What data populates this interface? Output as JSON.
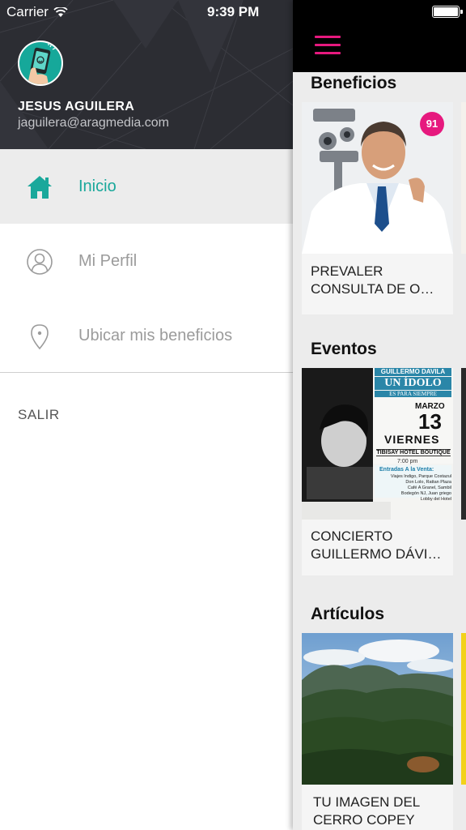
{
  "status_bar": {
    "carrier": "Carrier",
    "time": "9:39 PM"
  },
  "drawer": {
    "user": {
      "name": "JESUS AGUILERA",
      "email": "jaguilera@aragmedia.com"
    },
    "menu": [
      {
        "label": "Inicio",
        "icon": "home-icon",
        "active": true
      },
      {
        "label": "Mi Perfil",
        "icon": "user-icon",
        "active": false
      },
      {
        "label": "Ubicar mis beneficios",
        "icon": "location-pin-icon",
        "active": false
      }
    ],
    "logout_label": "SALIR"
  },
  "content": {
    "sections": [
      {
        "title": "Beneficios",
        "cards": [
          {
            "title": "PREVALER CONSULTA DE O…",
            "badge": "91"
          }
        ]
      },
      {
        "title": "Eventos",
        "cards": [
          {
            "title": "CONCIERTO GUILLERMO DÁVI…",
            "poster": {
              "artist": "GUILLERMO DAVILA",
              "headline": "UN ÍDOLO",
              "subheadline": "ES PARA SIEMPRE",
              "month": "MARZO",
              "day": "13",
              "weekday": "VIERNES",
              "venue": "TIBISAY HOTEL BOUTIQUE",
              "time": "7:00 pm",
              "sales_title": "Entradas A la Venta:",
              "sales_points": [
                "Viajes Indigo, Parque Costazul",
                "Don Lolo, Rattan Plaza",
                "Café A Granel, Sambil",
                "Bodegón NJ, Juan griego",
                "Lobby del Hotel"
              ]
            }
          }
        ]
      },
      {
        "title": "Artículos",
        "cards": [
          {
            "title": "TU IMAGEN DEL CERRO COPEY"
          }
        ]
      }
    ]
  },
  "colors": {
    "accent": "#1aa89b",
    "brand_pink": "#e6197e",
    "header_bg": "#2c2d33"
  }
}
